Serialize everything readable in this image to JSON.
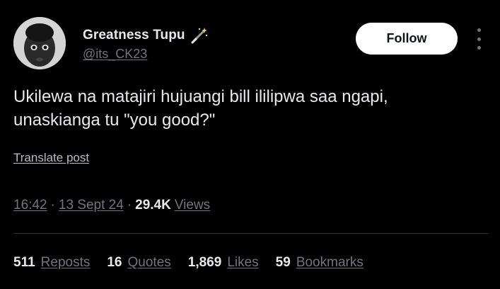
{
  "author": {
    "display_name": "Greatness Tupu",
    "handle": "@its_CK23",
    "emoji_icon": "magic-wand-icon"
  },
  "follow_label": "Follow",
  "tweet": {
    "text": "Ukilewa na matajiri hujuangi bill ililipwa saa ngapi,\nunaskianga tu \"you good?\"",
    "translate_label": "Translate post"
  },
  "meta": {
    "time": "16:42",
    "separator": "·",
    "date": "13 Sept 24",
    "views_count": "29.4K",
    "views_label": "Views"
  },
  "stats": [
    {
      "count": "511",
      "label": "Reposts"
    },
    {
      "count": "16",
      "label": "Quotes"
    },
    {
      "count": "1,869",
      "label": "Likes"
    },
    {
      "count": "59",
      "label": "Bookmarks"
    }
  ],
  "colors": {
    "background": "#000000",
    "text_primary": "#e7e9ea",
    "text_secondary": "#71767b",
    "divider": "#2f3336",
    "follow_bg": "#ffffff"
  }
}
